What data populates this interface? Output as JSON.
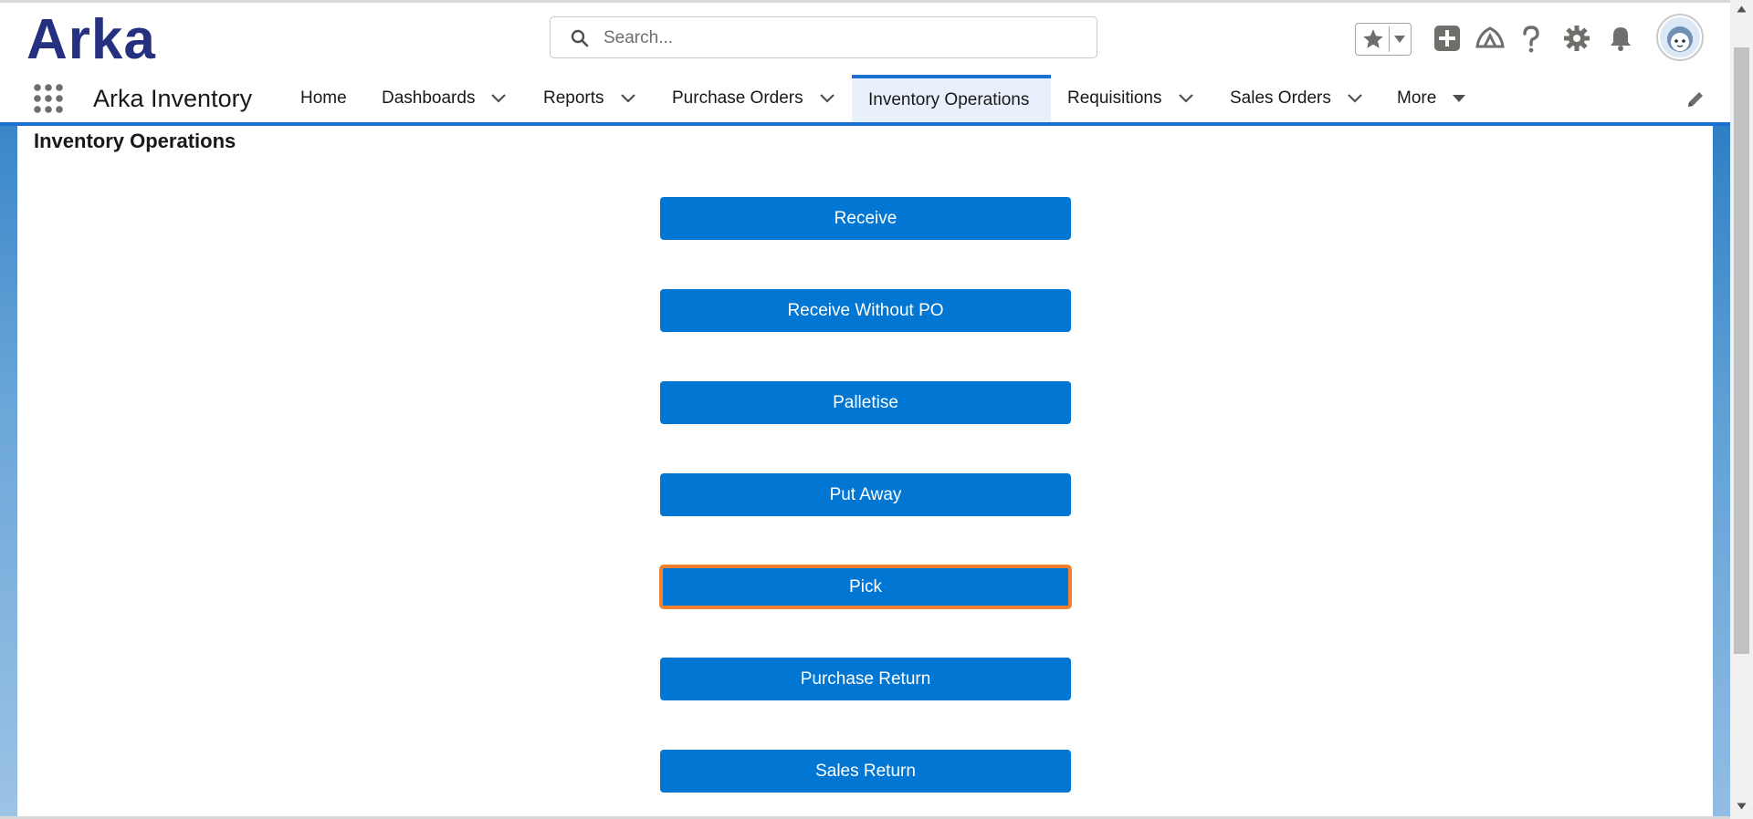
{
  "header": {
    "logo_text": "Arka",
    "search_placeholder": "Search..."
  },
  "navbar": {
    "app_name": "Arka Inventory",
    "items": [
      {
        "label": "Home",
        "has_menu": false
      },
      {
        "label": "Dashboards",
        "has_menu": true
      },
      {
        "label": "Reports",
        "has_menu": true
      },
      {
        "label": "Purchase Orders",
        "has_menu": true
      },
      {
        "label": "Inventory Operations",
        "has_menu": false,
        "active": true
      },
      {
        "label": "Requisitions",
        "has_menu": true
      },
      {
        "label": "Sales Orders",
        "has_menu": true
      },
      {
        "label": "More",
        "has_menu": true
      }
    ]
  },
  "page": {
    "title": "Inventory Operations",
    "buttons": [
      {
        "label": "Receive"
      },
      {
        "label": "Receive Without PO"
      },
      {
        "label": "Palletise"
      },
      {
        "label": "Put Away"
      },
      {
        "label": "Pick",
        "focused": true
      },
      {
        "label": "Purchase Return"
      },
      {
        "label": "Sales Return"
      }
    ]
  },
  "colors": {
    "brand": "#25317f",
    "primary_button": "#0176d3",
    "focus_ring": "#f0822f",
    "nav_accent": "#1b6fd0"
  }
}
